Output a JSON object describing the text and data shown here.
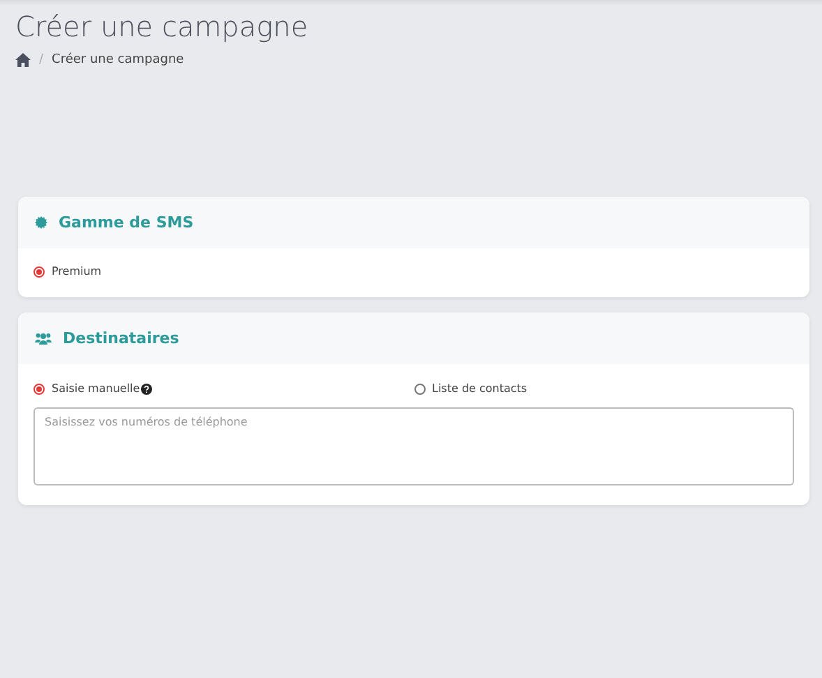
{
  "page": {
    "title": "Créer une campagne"
  },
  "breadcrumb": [
    {
      "kind": "home"
    },
    {
      "kind": "separator",
      "label": "/"
    },
    {
      "kind": "text",
      "label": "Créer une campagne"
    }
  ],
  "cards": [
    {
      "title": "Gamme de SMS",
      "kind": "range",
      "options": [
        {
          "label": "Premium",
          "selected": true,
          "help": false
        }
      ]
    },
    {
      "title": "Destinataires",
      "kind": "recipients",
      "options": [
        {
          "label": "Saisie manuelle",
          "selected": true,
          "help": true
        },
        {
          "label": "Liste de contacts",
          "selected": false,
          "help": false
        }
      ],
      "field": {
        "placeholder": "Saisissez vos numéros de téléphone"
      }
    }
  ]
}
